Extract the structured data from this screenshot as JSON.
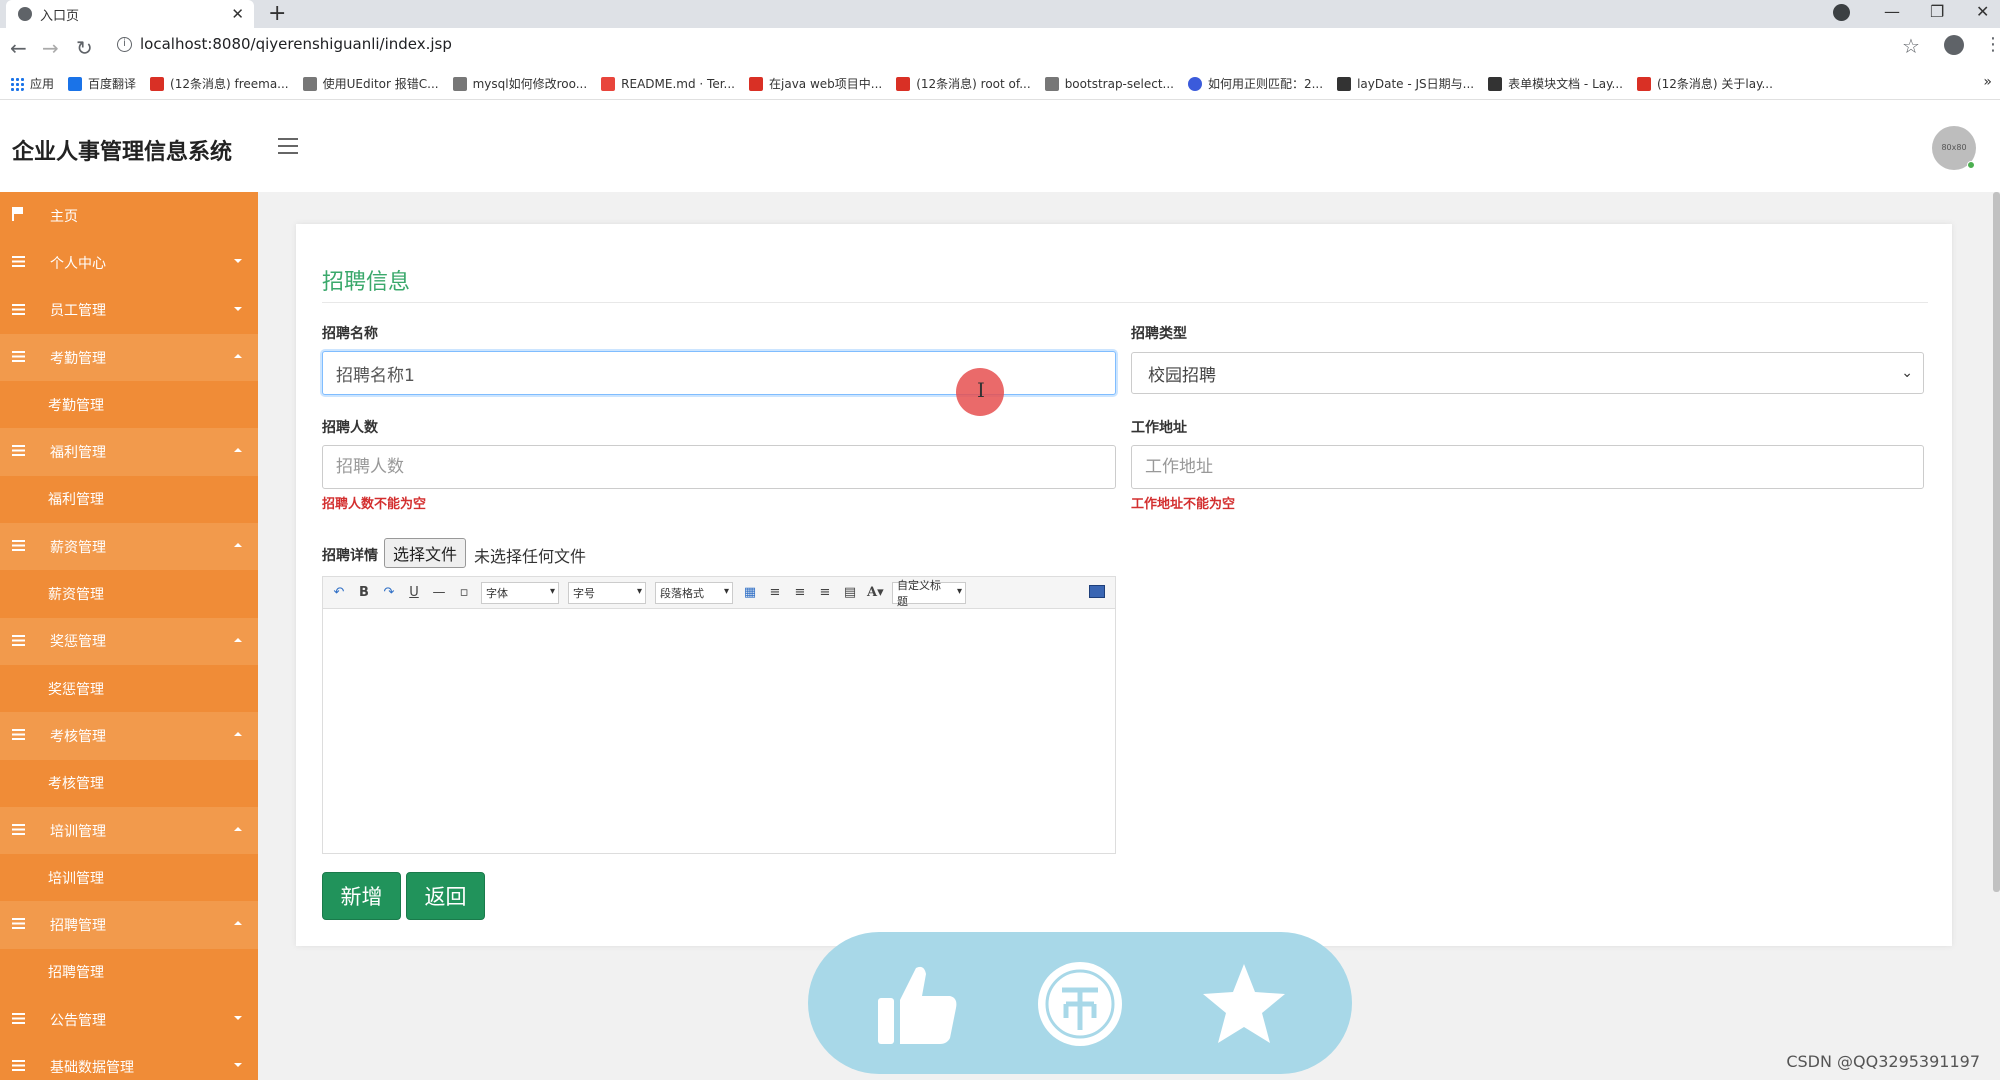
{
  "browser": {
    "tab_title": "入口页",
    "url": "localhost:8080/qiyerenshiguanli/index.jsp",
    "bookmarks": [
      {
        "label": "应用",
        "icon": "apps-grid-icon"
      },
      {
        "label": "百度翻译",
        "icon": "baidu-translate-icon"
      },
      {
        "label": "(12条消息) freema...",
        "icon": "csdn-icon"
      },
      {
        "label": "使用UEditor 报错C...",
        "icon": "bookmark-icon"
      },
      {
        "label": "mysql如何修改roo...",
        "icon": "bookmark-icon"
      },
      {
        "label": "README.md · Ter...",
        "icon": "gitee-icon"
      },
      {
        "label": "在java web项目中...",
        "icon": "csdn-icon"
      },
      {
        "label": "(12条消息) root of...",
        "icon": "csdn-icon"
      },
      {
        "label": "bootstrap-select...",
        "icon": "bookmark-icon"
      },
      {
        "label": "如何用正则匹配：2...",
        "icon": "baidu-icon"
      },
      {
        "label": "layDate - JS日期与...",
        "icon": "layui-icon"
      },
      {
        "label": "表单模块文档 - Lay...",
        "icon": "layui-icon"
      },
      {
        "label": "(12条消息) 关于lay...",
        "icon": "csdn-icon"
      }
    ]
  },
  "app": {
    "title": "企业人事管理信息系统",
    "avatar_text": "80x80"
  },
  "sidebar": {
    "items": [
      {
        "label": "主页",
        "type": "parent",
        "icon": "flag-icon"
      },
      {
        "label": "个人中心",
        "type": "parent",
        "icon": "grid-icon"
      },
      {
        "label": "员工管理",
        "type": "parent",
        "icon": "grid-icon"
      },
      {
        "label": "考勤管理",
        "type": "parent-open",
        "icon": "grid-icon"
      },
      {
        "label": "考勤管理",
        "type": "child"
      },
      {
        "label": "福利管理",
        "type": "parent-open",
        "icon": "grid-icon"
      },
      {
        "label": "福利管理",
        "type": "child"
      },
      {
        "label": "薪资管理",
        "type": "parent-open",
        "icon": "grid-icon"
      },
      {
        "label": "薪资管理",
        "type": "child"
      },
      {
        "label": "奖惩管理",
        "type": "parent-open",
        "icon": "grid-icon"
      },
      {
        "label": "奖惩管理",
        "type": "child"
      },
      {
        "label": "考核管理",
        "type": "parent-open",
        "icon": "grid-icon"
      },
      {
        "label": "考核管理",
        "type": "child"
      },
      {
        "label": "培训管理",
        "type": "parent-open",
        "icon": "grid-icon"
      },
      {
        "label": "培训管理",
        "type": "child"
      },
      {
        "label": "招聘管理",
        "type": "parent-open",
        "icon": "grid-icon"
      },
      {
        "label": "招聘管理",
        "type": "child"
      },
      {
        "label": "公告管理",
        "type": "parent",
        "icon": "grid-icon"
      },
      {
        "label": "基础数据管理",
        "type": "parent",
        "icon": "grid-icon"
      }
    ]
  },
  "form": {
    "title": "招聘信息",
    "name_label": "招聘名称",
    "name_value": "招聘名称1",
    "type_label": "招聘类型",
    "type_value": "校园招聘",
    "count_label": "招聘人数",
    "count_placeholder": "招聘人数",
    "count_error": "招聘人数不能为空",
    "address_label": "工作地址",
    "address_placeholder": "工作地址",
    "address_error": "工作地址不能为空",
    "detail_label": "招聘详情",
    "file_button": "选择文件",
    "file_status": "未选择任何文件",
    "add_button": "新增",
    "back_button": "返回"
  },
  "editor": {
    "font_select": "字体",
    "size_select": "字号",
    "paragraph_select": "段落格式",
    "custom_title_select": "自定义标题"
  },
  "colors": {
    "sidebar": "#f08c37",
    "accent_green": "#21935b",
    "title_green": "#3aa86b",
    "error_red": "#d32f2f",
    "overlay": "#a8d8e8"
  },
  "watermark": "CSDN @QQ3295391197"
}
